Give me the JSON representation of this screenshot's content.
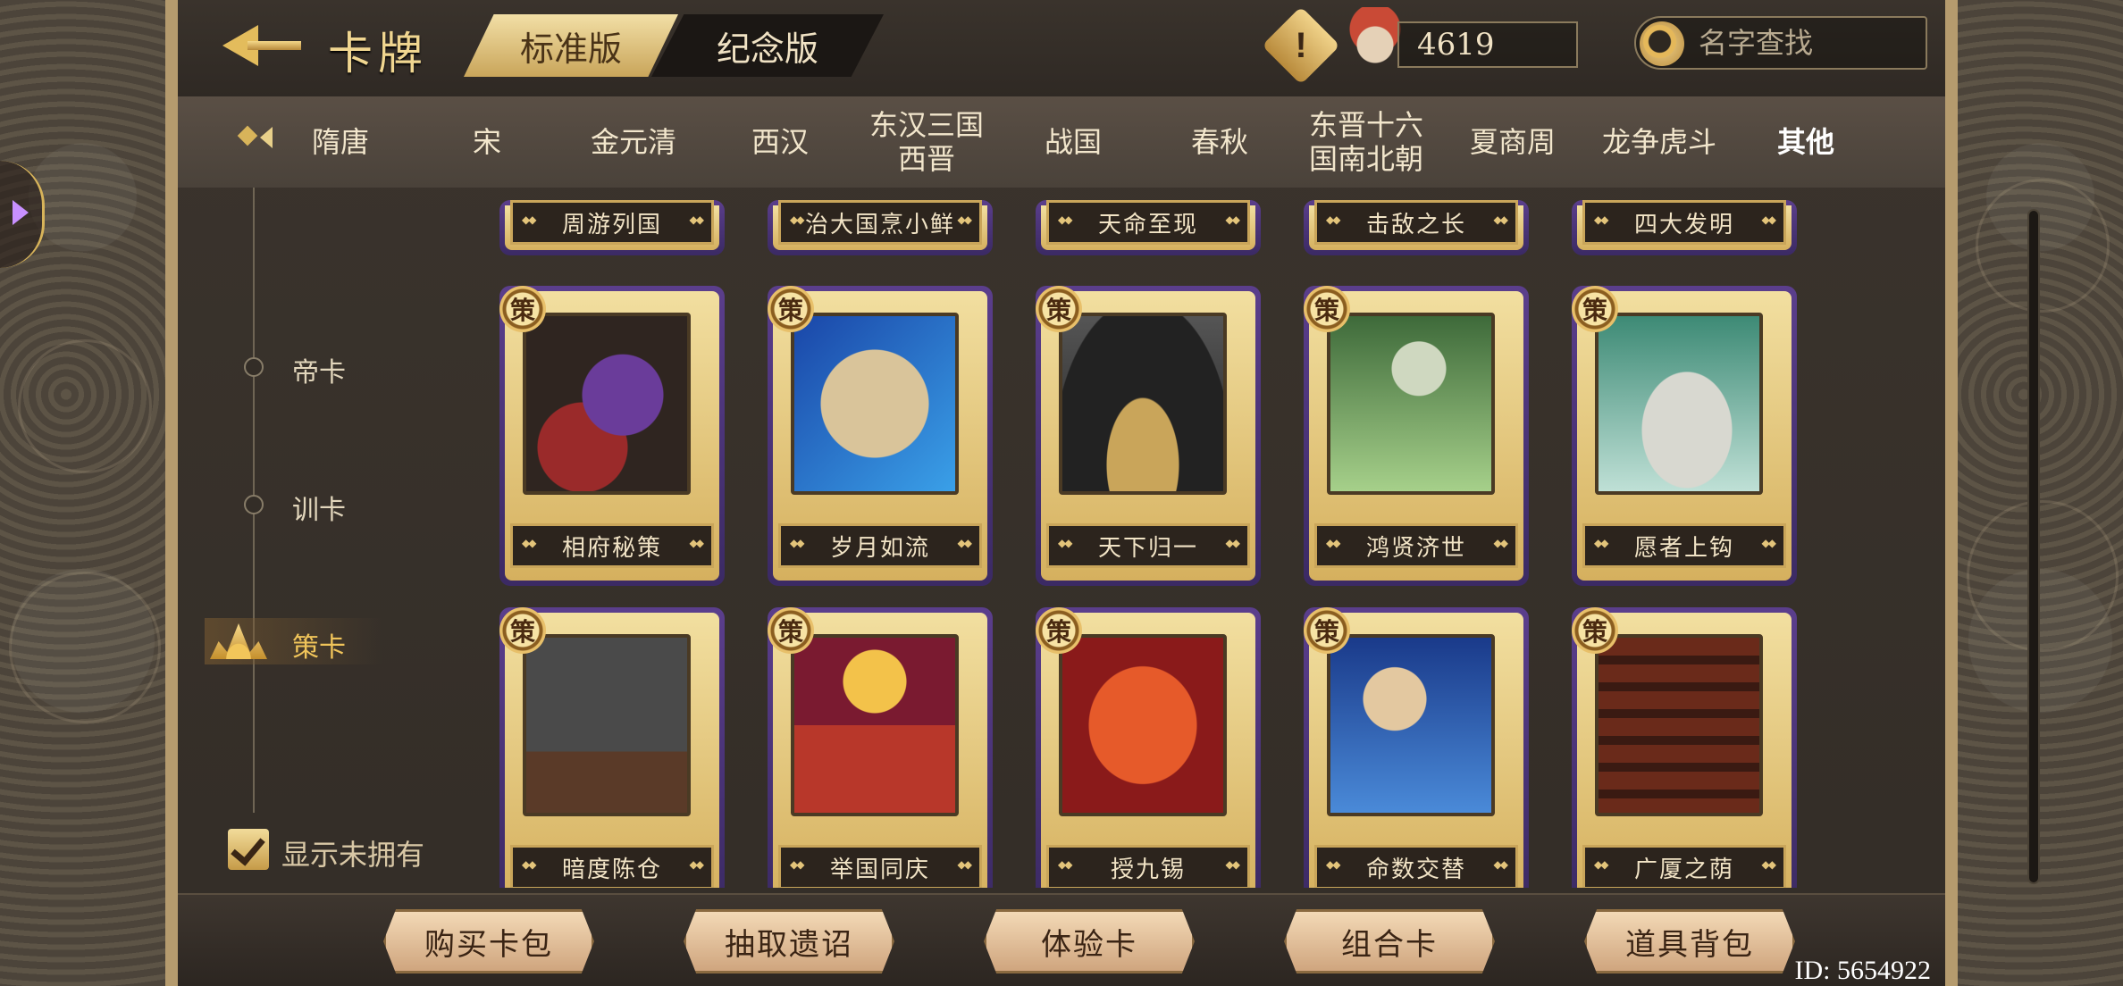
{
  "header": {
    "title": "卡牌",
    "version_tabs": [
      "标准版",
      "纪念版"
    ],
    "currency_value": "4619",
    "search_placeholder": "名字查找"
  },
  "categories": [
    "隋唐",
    "宋",
    "金元清",
    "西汉",
    "东汉三国\n西晋",
    "战国",
    "春秋",
    "东晋十六\n国南北朝",
    "夏商周",
    "龙争虎斗",
    "其他"
  ],
  "active_category": "其他",
  "left_menu": {
    "items": [
      "帝卡",
      "训卡",
      "策卡"
    ],
    "active": "策卡",
    "show_unowned_label": "显示未拥有",
    "show_unowned_checked": true
  },
  "cards": {
    "badge": "策",
    "row_partial": [
      "周游列国",
      "治大国烹小鲜",
      "天命至现",
      "击敌之长",
      "四大发明"
    ],
    "row1": [
      "相府秘策",
      "岁月如流",
      "天下归一",
      "鸿贤济世",
      "愿者上钩"
    ],
    "row2": [
      "暗度陈仓",
      "举国同庆",
      "授九锡",
      "命数交替",
      "广厦之荫"
    ]
  },
  "bottom_buttons": [
    "购买卡包",
    "抽取遗诏",
    "体验卡",
    "组合卡",
    "道具背包"
  ],
  "id_label": "ID: 5654922"
}
